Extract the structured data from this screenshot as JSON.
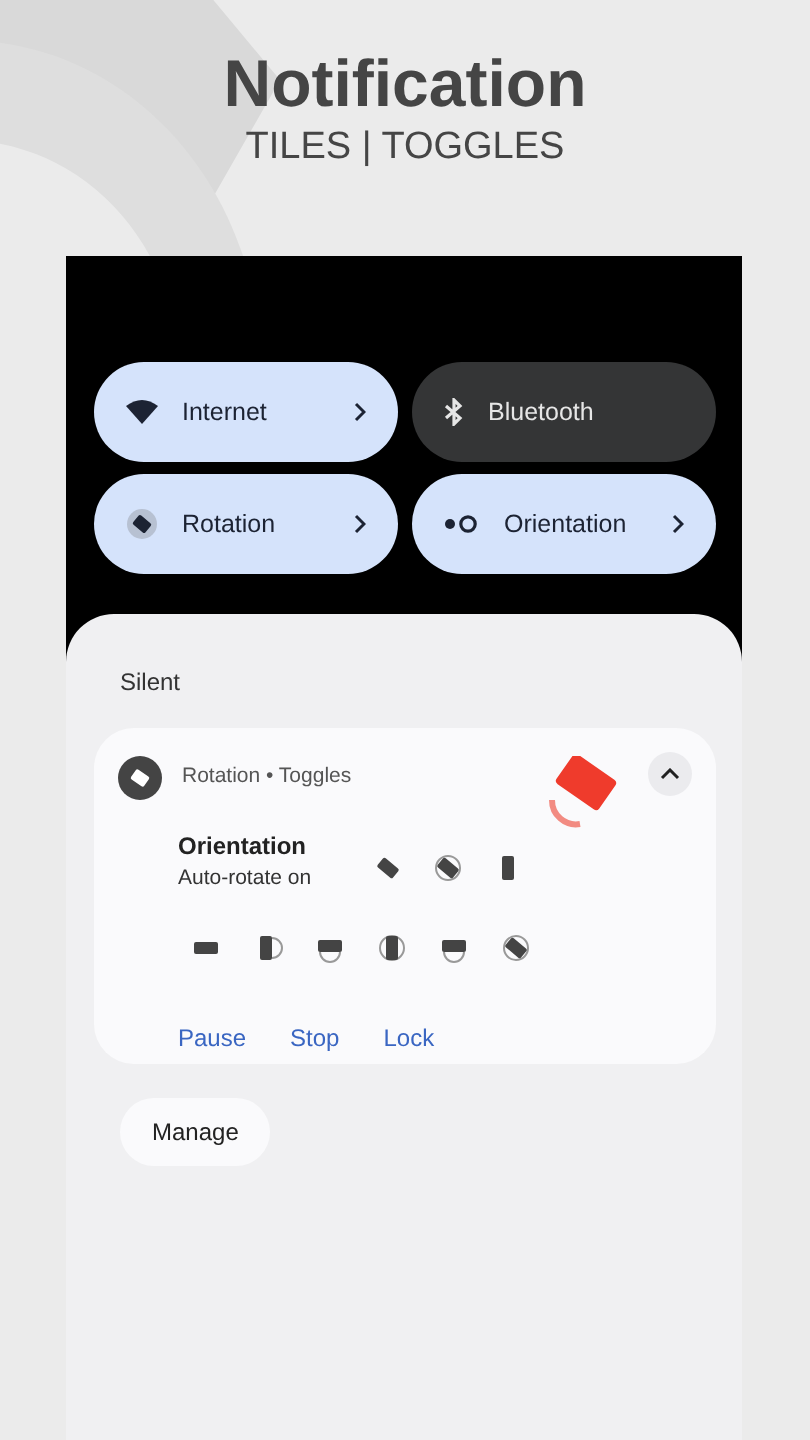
{
  "header": {
    "title": "Notification",
    "subtitle": "TILES | TOGGLES"
  },
  "tiles": [
    {
      "label": "Internet",
      "kind": "wifi",
      "on": true,
      "chevron": true
    },
    {
      "label": "Bluetooth",
      "kind": "bluetooth",
      "on": false,
      "chevron": false
    },
    {
      "label": "Rotation",
      "kind": "rotation",
      "on": true,
      "chevron": true
    },
    {
      "label": "Orientation",
      "kind": "orientation",
      "on": true,
      "chevron": true
    }
  ],
  "section": "Silent",
  "notification": {
    "app": "Rotation • Toggles",
    "title": "Orientation",
    "text": "Auto-rotate on",
    "expanded": true,
    "actions": [
      "Pause",
      "Stop",
      "Lock"
    ]
  },
  "manage_button": "Manage"
}
